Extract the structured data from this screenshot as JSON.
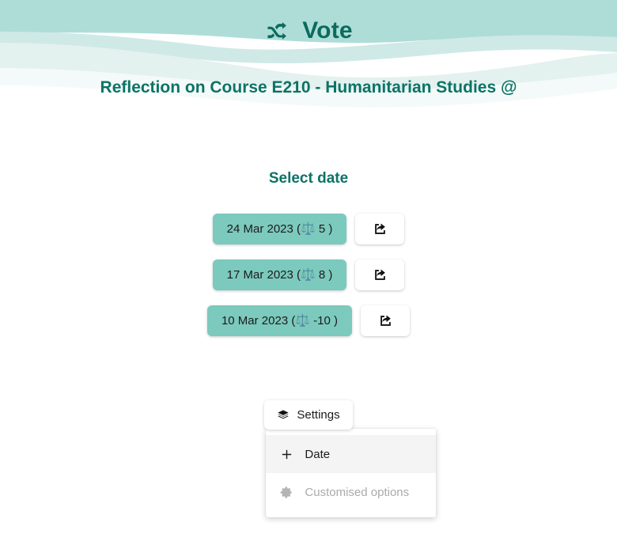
{
  "brand": {
    "icon": "shuffle-icon",
    "title": "Vote",
    "color": "#0b6b5f"
  },
  "page_title": "Reflection on Course E210 - Humanitarian Studies @",
  "section": {
    "heading": "Select date"
  },
  "dates": [
    {
      "label": "24 Mar 2023 (⚖️ 5 )",
      "date": "24 Mar 2023",
      "score": "5",
      "share_icon": "share-icon"
    },
    {
      "label": "17 Mar 2023 (⚖️ 8 )",
      "date": "17 Mar 2023",
      "score": "8",
      "share_icon": "share-icon"
    },
    {
      "label": "10 Mar 2023 (⚖️ -10 )",
      "date": "10 Mar 2023",
      "score": "-10",
      "share_icon": "share-icon"
    }
  ],
  "settings": {
    "label": "Settings",
    "icon": "layers-icon",
    "menu": [
      {
        "label": "Date",
        "icon": "plus-icon",
        "state": "hovered"
      },
      {
        "label": "Customised options",
        "icon": "gear-icon",
        "state": "disabled"
      }
    ]
  },
  "colors": {
    "accent_teal": "#7cc9bd",
    "brand_dark_teal": "#0b6b5f",
    "title_teal": "#0b7366",
    "banner_teal": "#aeddd8",
    "banner_light": "#dcefed",
    "page_background": "#ffffff"
  }
}
